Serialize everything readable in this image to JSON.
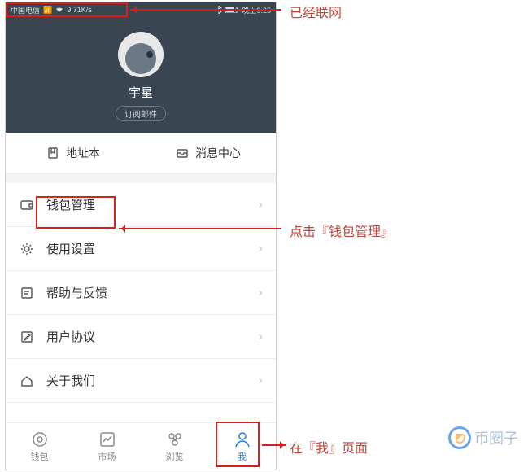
{
  "status": {
    "carrier": "中国电信",
    "speed": "9.71K/s",
    "time": "晚上9:25"
  },
  "profile": {
    "username": "宇星",
    "subscribe_label": "订阅邮件"
  },
  "quick": {
    "address_book": "地址本",
    "message_center": "消息中心"
  },
  "menu": {
    "wallet_manage": "钱包管理",
    "settings": "使用设置",
    "help": "帮助与反馈",
    "agreement": "用户协议",
    "about": "关于我们"
  },
  "tabs": {
    "wallet": "钱包",
    "market": "市场",
    "browse": "浏览",
    "me": "我"
  },
  "annotations": {
    "networked": "已经联网",
    "click_wallet": "点击『钱包管理』",
    "on_me_page": "在『我』页面"
  },
  "watermark": "币圈子"
}
